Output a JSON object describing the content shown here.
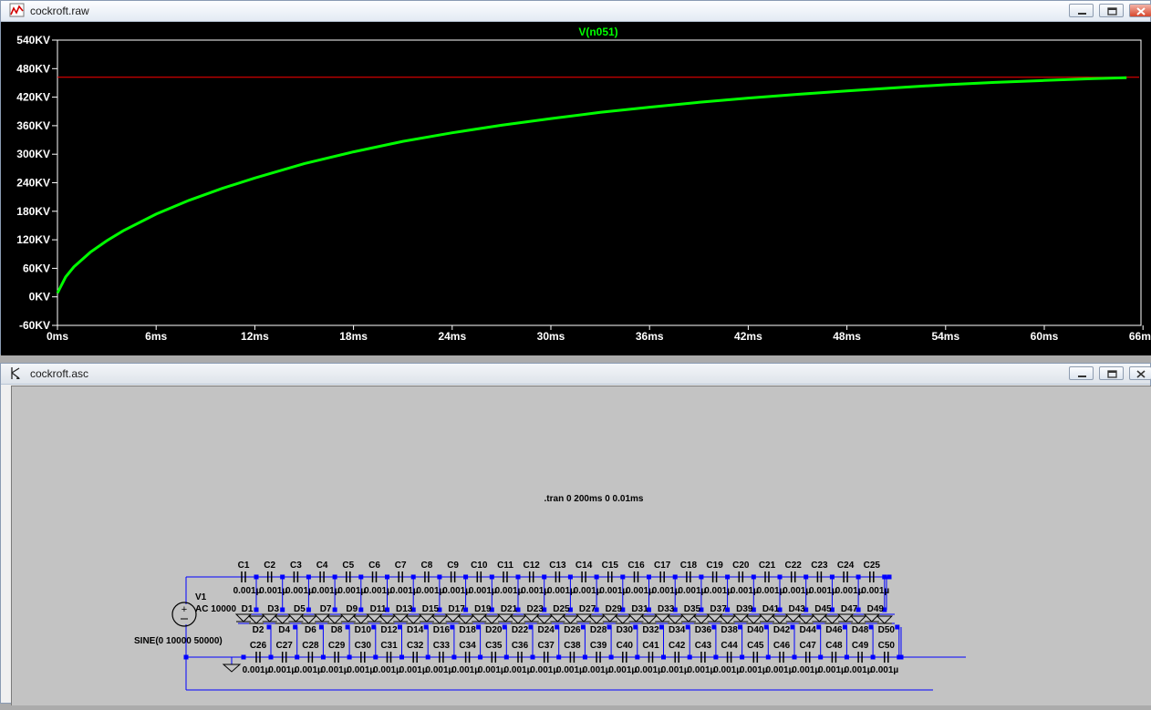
{
  "plot_window": {
    "title": "cockroft.raw",
    "icon": "waveform-icon",
    "controls": [
      "minimize",
      "maximize",
      "close"
    ]
  },
  "chart_data": {
    "type": "line",
    "title": "V(n051)",
    "xlabel": "",
    "ylabel": "",
    "x_ticks": [
      "0ms",
      "6ms",
      "12ms",
      "18ms",
      "24ms",
      "30ms",
      "36ms",
      "42ms",
      "48ms",
      "54ms",
      "60ms",
      "66ms"
    ],
    "y_ticks": [
      "540KV",
      "480KV",
      "420KV",
      "360KV",
      "300KV",
      "240KV",
      "180KV",
      "120KV",
      "60KV",
      "0KV",
      "-60KV"
    ],
    "xlim": [
      0,
      66
    ],
    "ylim": [
      -60,
      540
    ],
    "x_unit": "ms",
    "y_unit": "KV",
    "grid": false,
    "series": [
      {
        "name": "V(n051)",
        "color": "#00ff00",
        "x": [
          0,
          0.5,
          1,
          2,
          3,
          4,
          6,
          8,
          10,
          12,
          15,
          18,
          21,
          24,
          27,
          30,
          33,
          36,
          39,
          42,
          45,
          48,
          51,
          54,
          57,
          60,
          63,
          65
        ],
        "y": [
          8,
          42,
          63,
          94,
          118,
          139,
          174,
          203,
          228,
          250,
          280,
          305,
          327,
          345,
          361,
          375,
          388,
          399,
          409,
          418,
          426,
          433,
          440,
          446,
          451,
          455,
          459,
          461
        ]
      }
    ],
    "annotations": [
      {
        "type": "hline",
        "y": 462,
        "color": "#ff0000"
      }
    ],
    "colors": {
      "background": "#000000",
      "axes": "#ffffff",
      "trace": "#00ff00",
      "marker_line": "#ff0000"
    }
  },
  "schematic_window": {
    "title": "cockroft.asc",
    "icon": "schematic-icon",
    "directive": ".tran 0 200ms 0 0.01ms",
    "source": {
      "name": "V1",
      "value": "AC 10000",
      "function": "SINE(0 10000 50000)"
    },
    "top_capacitors": {
      "labels": [
        "C1",
        "C2",
        "C3",
        "C4",
        "C5",
        "C6",
        "C7",
        "C8",
        "C9",
        "C10",
        "C11",
        "C12",
        "C13",
        "C14",
        "C15",
        "C16",
        "C17",
        "C18",
        "C19",
        "C20",
        "C21",
        "C22",
        "C23",
        "C24",
        "C25"
      ],
      "value": "0.001µ"
    },
    "bottom_capacitors": {
      "labels": [
        "C26",
        "C27",
        "C28",
        "C29",
        "C30",
        "C31",
        "C32",
        "C33",
        "C34",
        "C35",
        "C36",
        "C37",
        "C38",
        "C39",
        "C40",
        "C41",
        "C42",
        "C43",
        "C44",
        "C45",
        "C46",
        "C47",
        "C48",
        "C49",
        "C50"
      ],
      "value": "0.001µ"
    },
    "diodes_upper": [
      "D1",
      "D3",
      "D5",
      "D7",
      "D9",
      "D11",
      "D13",
      "D15",
      "D17",
      "D19",
      "D21",
      "D23",
      "D25",
      "D27",
      "D29",
      "D31",
      "D33",
      "D35",
      "D37",
      "D39",
      "D41",
      "D43",
      "D45",
      "D47",
      "D49"
    ],
    "diodes_lower": [
      "D2",
      "D4",
      "D6",
      "D8",
      "D10",
      "D12",
      "D14",
      "D16",
      "D18",
      "D20",
      "D22",
      "D24",
      "D26",
      "D28",
      "D30",
      "D32",
      "D34",
      "D36",
      "D38",
      "D40",
      "D42",
      "D44",
      "D46",
      "D48",
      "D50"
    ],
    "colors": {
      "background": "#c3c3c3",
      "wire": "#0000ff",
      "component": "#000000",
      "text": "#000000"
    }
  }
}
